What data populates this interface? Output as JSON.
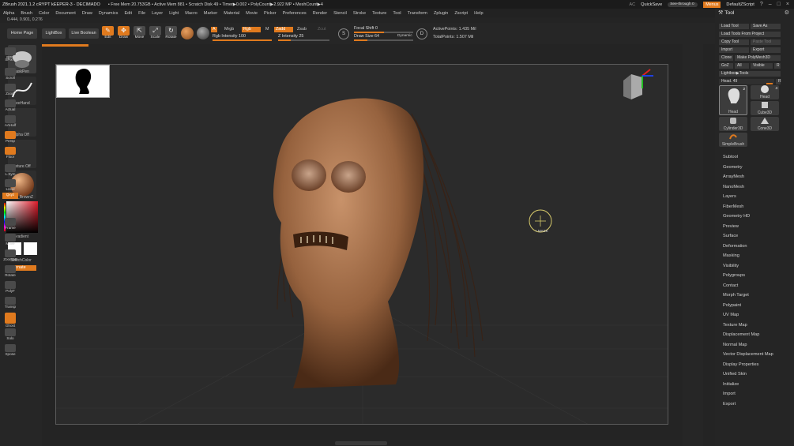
{
  "titlebar": {
    "title": "ZBrush 2021.1.2    cRYPT kEEPER-3 - DECIMADO",
    "stats": "• Free Mem 20.753GB • Active Mem 881 • Scratch Disk 49 • Timer▶0.002 • PolyCount▶2.922 MP • MeshCount▶4",
    "ac": "AC",
    "quicksave": "QuickSave",
    "seethrough": "See-through  0",
    "menus": "Menus",
    "default_zscript": "DefaultZScript"
  },
  "menu": [
    "Alpha",
    "Brush",
    "Color",
    "Document",
    "Draw",
    "Dynamics",
    "Edit",
    "File",
    "Layer",
    "Light",
    "Macro",
    "Marker",
    "Material",
    "Movie",
    "Picker",
    "Preferences",
    "Render",
    "Stencil",
    "Stroke",
    "Texture",
    "Tool",
    "Transform",
    "Zplugin",
    "Zscript",
    "Help"
  ],
  "coords": "0.444, 0.901, 0.276",
  "shelf": {
    "home_page": "Home Page",
    "lightbox": "LightBox",
    "live_boolean": "Live Boolean",
    "edit": "Edit",
    "draw": "Draw",
    "move": "Move",
    "scale": "Scale",
    "rotate": "Rotate",
    "a": "A",
    "mrgb": "Mrgb",
    "rgb": "Rgb",
    "m": "M",
    "zadd": "Zadd",
    "zsub": "Zsub",
    "zcut": "Zcut",
    "rgb_intensity": "Rgb Intensity 100",
    "z_intensity": "Z Intensity 25",
    "focal_shift": "Focal Shift  0",
    "draw_size": "Draw Size  64",
    "dynamic": "Dynamic",
    "active_points": "ActivePoints: 1.435 Mil",
    "total_points": "TotalPoints: 1.507 Mil"
  },
  "left": {
    "maskpen": "MaskPen",
    "freehand": "FreeHand",
    "alpha_off": "Alpha Off",
    "texture_off": "Texture Off",
    "material": "ZBro_BrownZ",
    "gradient": "Gradient",
    "switchcolor": "SwitchColor",
    "alternate": "Alternate"
  },
  "right_shelf": [
    "BPR",
    "SPix 3",
    "Scroll",
    "Zoom",
    "Actual",
    "AAHalf",
    "Persp",
    "Floor",
    "L.Sym",
    "Local",
    "Qxyz",
    "Frame",
    "Move",
    "Zoom3D",
    "Rotate",
    "PolyF",
    "Transp",
    "Ghost",
    "Solo",
    "Xpose"
  ],
  "tool_panel": {
    "header": "Tool",
    "load_tool": "Load Tool",
    "save_as": "Save As",
    "load_from_project": "Load Tools From Project",
    "copy_tool": "Copy Tool",
    "paste_tool": "Paste Tool",
    "import": "Import",
    "export": "Export",
    "clone": "Clone",
    "make_polymesh": "Make PolyMesh3D",
    "goz": "GoZ",
    "all": "All",
    "visible": "Visible",
    "r": "R",
    "lightbox_tools": "Lightbox▶Tools",
    "head_slider": "Head. 49",
    "thumbs": [
      "Head",
      "Head",
      "Cylinder3D",
      "Cube3D",
      "Cone3D",
      "SimpleBrush"
    ],
    "thumb_badges": [
      "2",
      "4"
    ],
    "subpalettes": [
      "Subtool",
      "Geometry",
      "ArrayMesh",
      "NanoMesh",
      "Layers",
      "FiberMesh",
      "Geometry HD",
      "Preview",
      "Surface",
      "Deformation",
      "Masking",
      "Visibility",
      "Polygroups",
      "Contact",
      "Morph Target",
      "Polypaint",
      "UV Map",
      "Texture Map",
      "Displacement Map",
      "Normal Map",
      "Vector Displacement Map",
      "Display Properties",
      "Unified Skin",
      "Initialize",
      "Import",
      "Export"
    ]
  },
  "canvas": {
    "brush_label": "+ MASK"
  },
  "colors": {
    "accent": "#e07a1e",
    "skin": "#9a6d4a",
    "bg": "#2b2b2b"
  }
}
